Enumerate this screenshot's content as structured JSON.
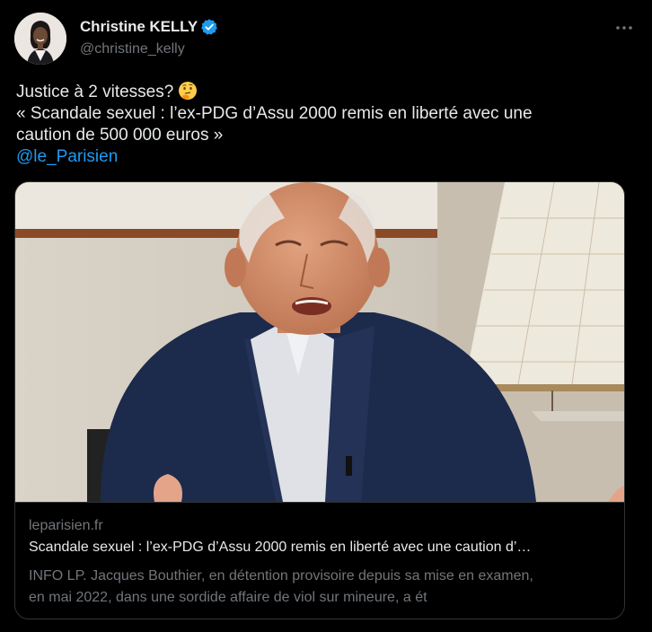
{
  "author": {
    "display_name": "Christine KELLY",
    "handle": "@christine_kelly",
    "verified_color": "#1d9bf0"
  },
  "tweet": {
    "line1": "Justice à 2 vitesses?",
    "emoji": "thinking-face",
    "line2": "« Scandale sexuel : l’ex-PDG d’Assu 2000 remis en liberté avec une",
    "line3": "caution de 500 000 euros »",
    "mention": "@le_Parisien"
  },
  "card": {
    "domain": "leparisien.fr",
    "title": "Scandale sexuel : l’ex-PDG d’Assu 2000 remis en liberté avec une caution d’…",
    "description_line1": "INFO LP. Jacques Bouthier, en détention provisoire depuis sa mise en examen,",
    "description_line2": "en mai 2022, dans une sordide affaire de viol sur mineure, a ét"
  },
  "colors": {
    "background": "#000000",
    "text": "#e7e9ea",
    "secondary": "#71767b",
    "link": "#1d9bf0",
    "border": "#2f3336"
  },
  "icons": {
    "more": "more-horizontal-icon",
    "verified": "verified-badge-icon"
  }
}
